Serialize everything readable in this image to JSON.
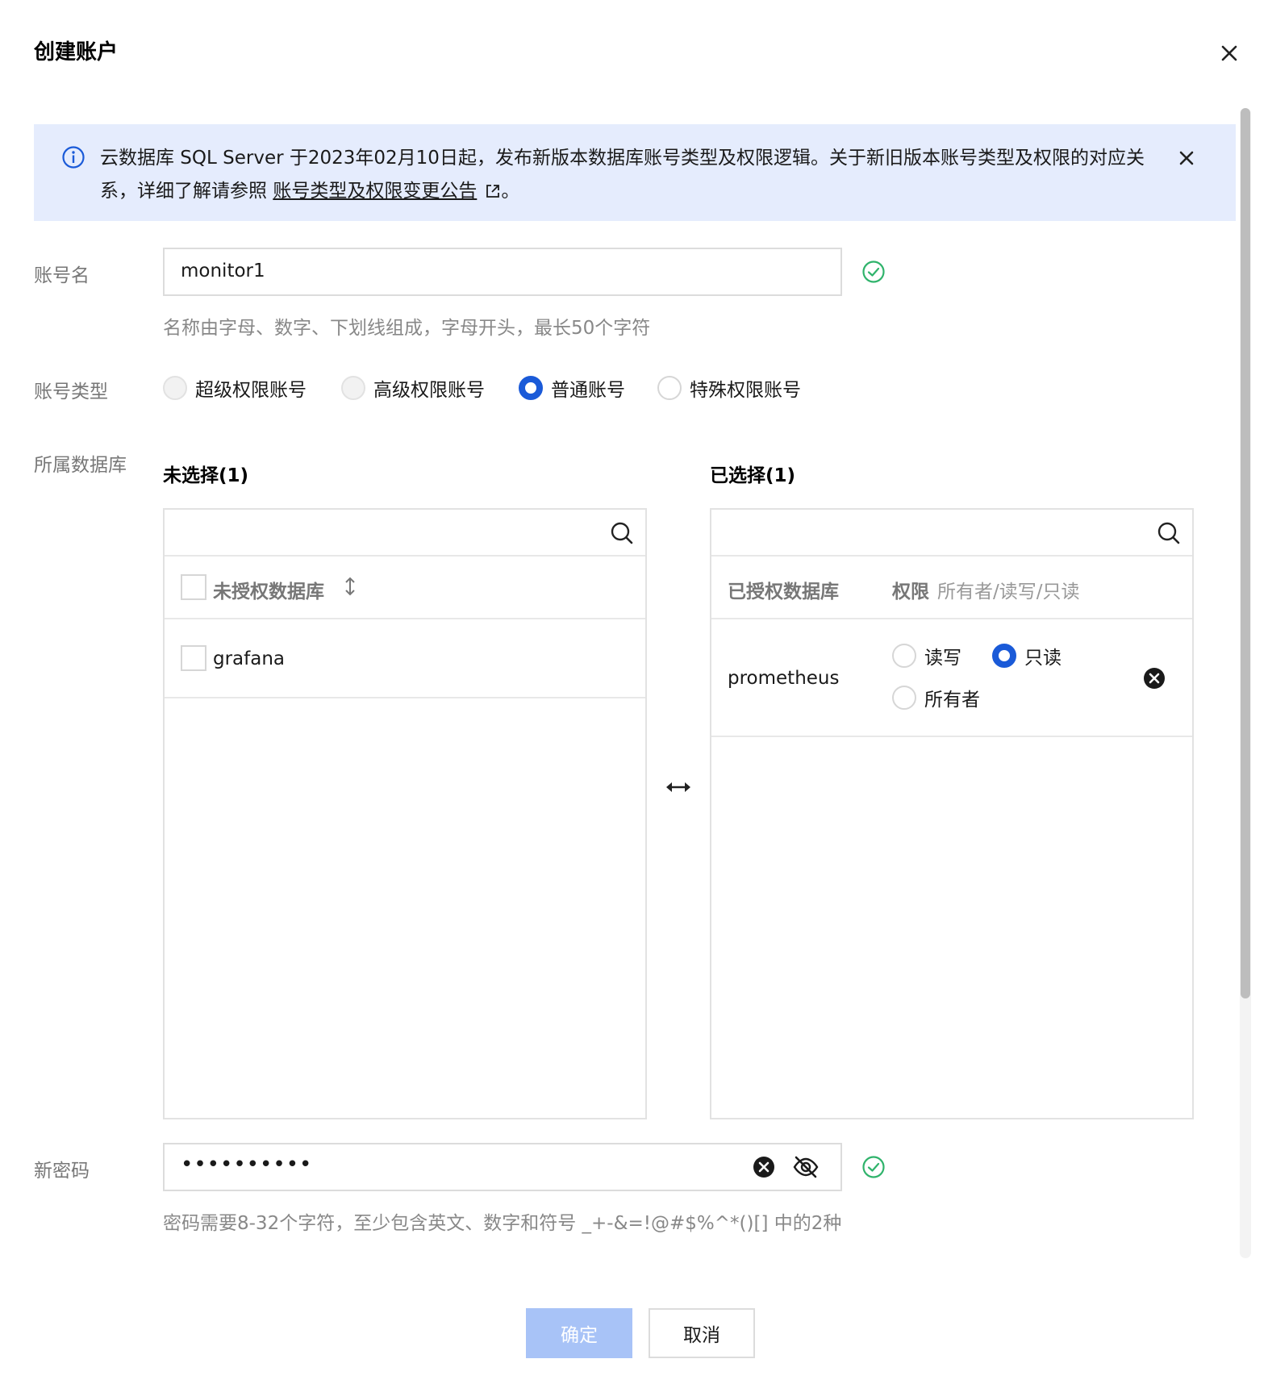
{
  "dialog": {
    "title": "创建账户"
  },
  "notice": {
    "text_before": "云数据库 SQL Server 于2023年02月10日起，发布新版本数据库账号类型及权限逻辑。关于新旧版本账号类型及权限的对应关系，详细了解请参照 ",
    "link": "账号类型及权限变更公告",
    "text_after": "。"
  },
  "account_name": {
    "label": "账号名",
    "value": "monitor1",
    "hint": "名称由字母、数字、下划线组成，字母开头，最长50个字符"
  },
  "account_type": {
    "label": "账号类型",
    "options": [
      {
        "label": "超级权限账号",
        "state": "disabled"
      },
      {
        "label": "高级权限账号",
        "state": "disabled"
      },
      {
        "label": "普通账号",
        "state": "checked"
      },
      {
        "label": "特殊权限账号",
        "state": "unchecked"
      }
    ]
  },
  "database": {
    "label": "所属数据库",
    "unselected": {
      "title": "未选择(1)",
      "column": "未授权数据库",
      "items": [
        "grafana"
      ]
    },
    "selected": {
      "title": "已选择(1)",
      "column": "已授权数据库",
      "perm_label": "权限",
      "perm_desc": "所有者/读写/只读",
      "items": [
        {
          "name": "prometheus",
          "perms": [
            {
              "label": "读写",
              "checked": false
            },
            {
              "label": "只读",
              "checked": true
            },
            {
              "label": "所有者",
              "checked": false
            }
          ]
        }
      ]
    }
  },
  "password": {
    "label": "新密码",
    "value": "••••••••••",
    "hint": "密码需要8-32个字符，至少包含英文、数字和符号 _+-&=!@#$%^*()[] 中的2种"
  },
  "buttons": {
    "confirm": "确定",
    "cancel": "取消"
  },
  "colors": {
    "accent": "#1a5ad8",
    "notice_bg": "#e5ecfd",
    "success": "#2fb36b",
    "primary_disabled": "#a8c3f7"
  }
}
